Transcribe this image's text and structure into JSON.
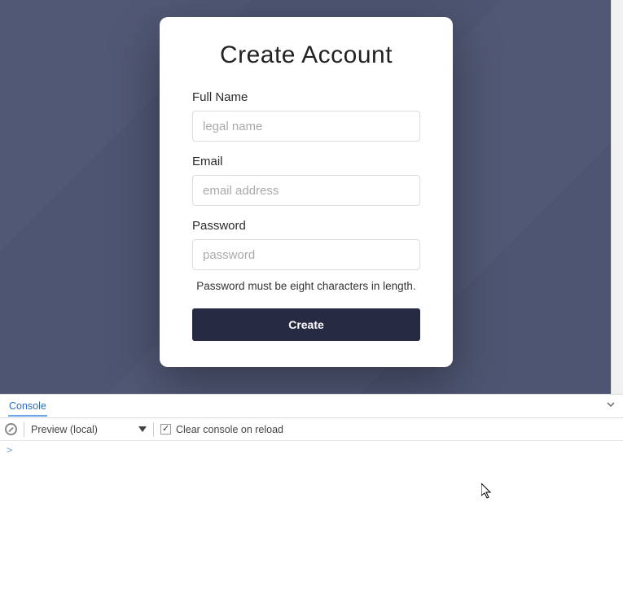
{
  "form": {
    "title": "Create Account",
    "fields": {
      "full_name": {
        "label": "Full Name",
        "placeholder": "legal name"
      },
      "email": {
        "label": "Email",
        "placeholder": "email address"
      },
      "password": {
        "label": "Password",
        "placeholder": "password",
        "helper": "Password must be eight characters in length."
      }
    },
    "submit_label": "Create"
  },
  "devtools": {
    "tab_label": "Console",
    "context_selector": "Preview (local)",
    "clear_on_reload_label": "Clear console on reload",
    "clear_on_reload_checked": true,
    "prompt": ">"
  }
}
